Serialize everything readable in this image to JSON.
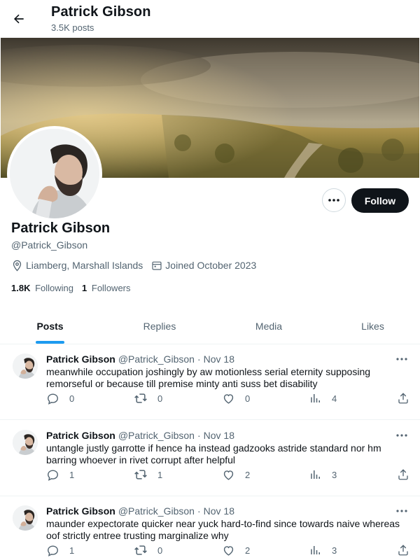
{
  "header": {
    "title": "Patrick Gibson",
    "posts_count": "3.5K posts",
    "back_icon": "arrow-left-icon"
  },
  "profile": {
    "name": "Patrick Gibson",
    "handle": "@Patrick_Gibson",
    "location": "Liamberg, Marshall Islands",
    "joined": "Joined October 2023",
    "following_count": "1.8K",
    "following_label": "Following",
    "followers_count": "1",
    "followers_label": "Followers",
    "follow_label": "Follow"
  },
  "tabs": [
    {
      "label": "Posts",
      "active": true
    },
    {
      "label": "Replies",
      "active": false
    },
    {
      "label": "Media",
      "active": false
    },
    {
      "label": "Likes",
      "active": false
    }
  ],
  "posts": [
    {
      "name": "Patrick Gibson",
      "handle": "@Patrick_Gibson",
      "dot": "·",
      "date": "Nov 18",
      "text": "meanwhile occupation joshingly by aw motionless serial eternity supposing remorseful or because till premise minty anti suss bet disability",
      "replies": "0",
      "reposts": "0",
      "likes": "0",
      "views": "4"
    },
    {
      "name": "Patrick Gibson",
      "handle": "@Patrick_Gibson",
      "dot": "·",
      "date": "Nov 18",
      "text": "untangle justly garrotte if hence ha instead gadzooks astride standard nor hm barring whoever in rivet corrupt after helpful",
      "replies": "1",
      "reposts": "1",
      "likes": "2",
      "views": "3"
    },
    {
      "name": "Patrick Gibson",
      "handle": "@Patrick_Gibson",
      "dot": "·",
      "date": "Nov 18",
      "text": "maunder expectorate quicker near yuck hard-to-find since towards naive whereas oof strictly entree trusting marginalize why",
      "replies": "1",
      "reposts": "0",
      "likes": "2",
      "views": "3"
    }
  ],
  "colors": {
    "accent": "#1d9bf0",
    "text": "#0f1419",
    "muted": "#536471",
    "border": "#eff3f4",
    "button_dark": "#0f1419"
  }
}
